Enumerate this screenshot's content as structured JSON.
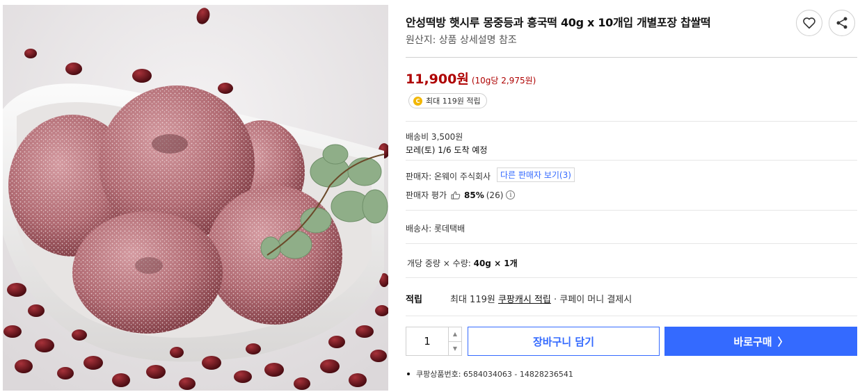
{
  "product": {
    "image_alt": "안성떡방 햇시루 몽중등과 흥국떡",
    "title": "안성떡방 햇시루 몽중등과 흥국떡 40g x 10개입 개별포장 찹쌀떡",
    "origin": "원산지: 상품 상세설명 참조"
  },
  "actions": {
    "like_icon": "heart-icon",
    "share_icon": "share-icon"
  },
  "price": {
    "amount": "11,900원",
    "unit_price": "(10g당 2,975원)",
    "color": "#ae0000"
  },
  "reward": {
    "coin_symbol": "C",
    "text": "최대 119원 적립"
  },
  "shipping": {
    "fee": "배송비 3,500원",
    "arrival": "모레(토) 1/6 도착 예정"
  },
  "seller": {
    "label": "판매자: 온웨이 주식회사",
    "other_sellers": "다른 판매자 보기(3)",
    "rating_label": "판매자 평가",
    "rating_pct": "85%",
    "rating_count": "(26)",
    "info_symbol": "i"
  },
  "carrier": "배송사: 롯데택배",
  "weight": {
    "label": "개당 중량 × 수량: ",
    "value": "40g × 1개"
  },
  "points": {
    "label": "적립",
    "prefix": "최대 119원 ",
    "link": "쿠팡캐시 적립",
    "suffix": " · 쿠페이 머니 결제시"
  },
  "purchase": {
    "quantity": "1",
    "up": "▲",
    "down": "▼",
    "cart_label": "장바구니 담기",
    "buy_label": "바로구매",
    "buy_chevron": "〉",
    "accent": "#346aff"
  },
  "product_no": "쿠팡상품번호: 6584034063 - 14828236541"
}
